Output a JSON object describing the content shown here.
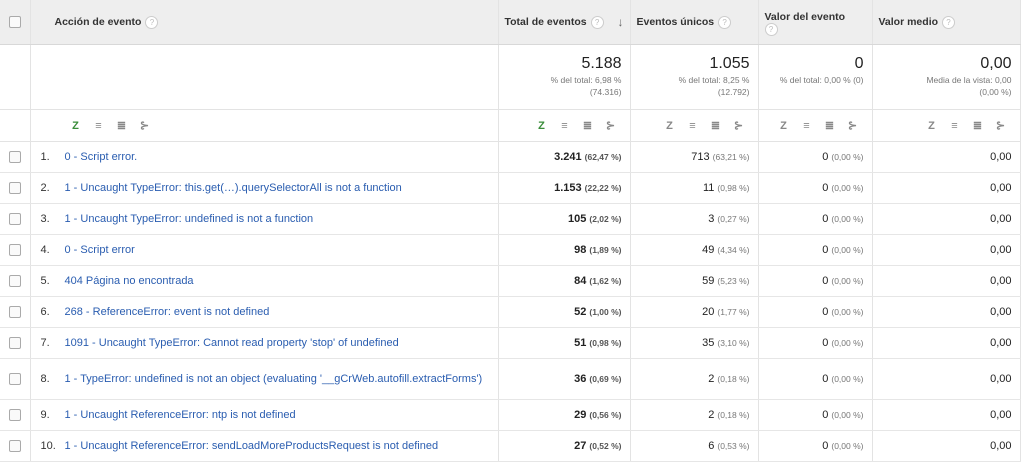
{
  "headers": {
    "action": "Acción de evento",
    "total": "Total de eventos",
    "unique": "Eventos únicos",
    "value": "Valor del evento",
    "avg": "Valor medio"
  },
  "totals": {
    "total": {
      "value": "5.188",
      "sub1": "% del total: 6,98 %",
      "sub2": "(74.316)"
    },
    "unique": {
      "value": "1.055",
      "sub1": "% del total: 8,25 %",
      "sub2": "(12.792)"
    },
    "value": {
      "value": "0",
      "sub1": "% del total: 0,00 % (0)"
    },
    "avg": {
      "value": "0,00",
      "sub1": "Media de la vista: 0,00",
      "sub2": "(0,00 %)"
    }
  },
  "rows": [
    {
      "num": "1.",
      "action": "0 - Script error.",
      "total": "3.241",
      "total_pct": "(62,47 %)",
      "unique": "713",
      "unique_pct": "(63,21 %)",
      "value": "0",
      "value_pct": "(0,00 %)",
      "avg": "0,00"
    },
    {
      "num": "2.",
      "action": "1 - Uncaught TypeError: this.get(…).querySelectorAll is not a function",
      "total": "1.153",
      "total_pct": "(22,22 %)",
      "unique": "11",
      "unique_pct": "(0,98 %)",
      "value": "0",
      "value_pct": "(0,00 %)",
      "avg": "0,00"
    },
    {
      "num": "3.",
      "action": "1 - Uncaught TypeError: undefined is not a function",
      "total": "105",
      "total_pct": "(2,02 %)",
      "unique": "3",
      "unique_pct": "(0,27 %)",
      "value": "0",
      "value_pct": "(0,00 %)",
      "avg": "0,00"
    },
    {
      "num": "4.",
      "action": "0 - Script error",
      "total": "98",
      "total_pct": "(1,89 %)",
      "unique": "49",
      "unique_pct": "(4,34 %)",
      "value": "0",
      "value_pct": "(0,00 %)",
      "avg": "0,00"
    },
    {
      "num": "5.",
      "action": "404 Página no encontrada",
      "total": "84",
      "total_pct": "(1,62 %)",
      "unique": "59",
      "unique_pct": "(5,23 %)",
      "value": "0",
      "value_pct": "(0,00 %)",
      "avg": "0,00"
    },
    {
      "num": "6.",
      "action": "268 - ReferenceError: event is not defined",
      "total": "52",
      "total_pct": "(1,00 %)",
      "unique": "20",
      "unique_pct": "(1,77 %)",
      "value": "0",
      "value_pct": "(0,00 %)",
      "avg": "0,00"
    },
    {
      "num": "7.",
      "action": "1091 - Uncaught TypeError: Cannot read property 'stop' of undefined",
      "total": "51",
      "total_pct": "(0,98 %)",
      "unique": "35",
      "unique_pct": "(3,10 %)",
      "value": "0",
      "value_pct": "(0,00 %)",
      "avg": "0,00"
    },
    {
      "num": "8.",
      "action": "1 - TypeError: undefined is not an object (evaluating '__gCrWeb.autofill.extractForms')",
      "total": "36",
      "total_pct": "(0,69 %)",
      "unique": "2",
      "unique_pct": "(0,18 %)",
      "value": "0",
      "value_pct": "(0,00 %)",
      "avg": "0,00"
    },
    {
      "num": "9.",
      "action": "1 - Uncaught ReferenceError: ntp is not defined",
      "total": "29",
      "total_pct": "(0,56 %)",
      "unique": "2",
      "unique_pct": "(0,18 %)",
      "value": "0",
      "value_pct": "(0,00 %)",
      "avg": "0,00"
    },
    {
      "num": "10.",
      "action": "1 - Uncaught ReferenceError: sendLoadMoreProductsRequest is not defined",
      "total": "27",
      "total_pct": "(0,52 %)",
      "unique": "6",
      "unique_pct": "(0,53 %)",
      "value": "0",
      "value_pct": "(0,00 %)",
      "avg": "0,00"
    }
  ],
  "colors": {
    "link": "#2a5db0",
    "header_bg": "#eeeeee",
    "selected_icon": "#3a8d3a"
  },
  "icons": [
    "help-icon",
    "sort-desc-arrow-icon",
    "pie-chart-icon",
    "performance-bars-icon",
    "comparison-icon",
    "term-cloud-icon"
  ]
}
